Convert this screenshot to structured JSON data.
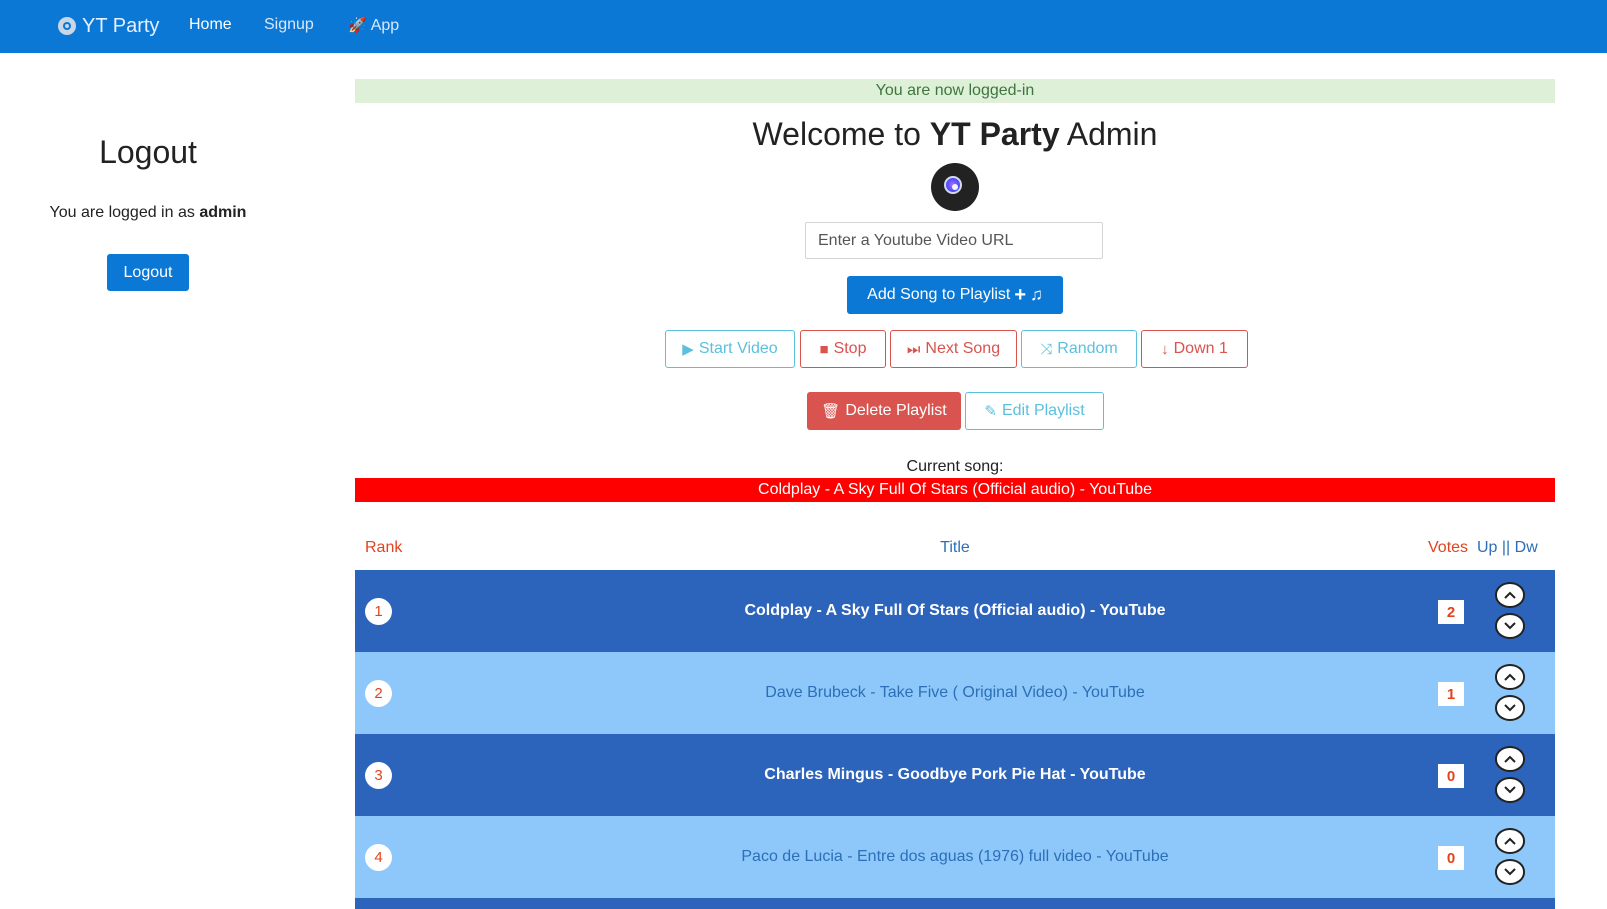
{
  "navbar": {
    "brand": "YT Party",
    "links": [
      {
        "label": "Home",
        "active": true
      },
      {
        "label": "Signup",
        "active": false
      },
      {
        "label": "App",
        "active": false,
        "icon": "rocket-icon"
      }
    ]
  },
  "sidebar": {
    "title": "Logout",
    "logged_prefix": "You are logged in as",
    "username": "admin",
    "logout_button": "Logout"
  },
  "alert": "You are now logged-in",
  "welcome": {
    "prefix": "Welcome to",
    "brand": "YT Party",
    "suffix": "Admin"
  },
  "url_input": {
    "placeholder": "Enter a Youtube Video URL",
    "value": ""
  },
  "add_button": "Add Song to Playlist",
  "controls": {
    "start": "Start Video",
    "stop": "Stop",
    "next": "Next Song",
    "random": "Random",
    "down": "Down 1",
    "delete": "Delete Playlist",
    "edit": "Edit Playlist"
  },
  "current": {
    "label": "Current song:",
    "title": "Coldplay - A Sky Full Of Stars (Official audio) - YouTube"
  },
  "table": {
    "headers": {
      "rank": "Rank",
      "title": "Title",
      "votes": "Votes",
      "updw": "Up || Dw"
    },
    "rows": [
      {
        "rank": "1",
        "title": "Coldplay - A Sky Full Of Stars (Official audio) - YouTube",
        "votes": "2"
      },
      {
        "rank": "2",
        "title": "Dave Brubeck - Take Five ( Original Video) - YouTube",
        "votes": "1"
      },
      {
        "rank": "3",
        "title": "Charles Mingus - Goodbye Pork Pie Hat - YouTube",
        "votes": "0"
      },
      {
        "rank": "4",
        "title": "Paco de Lucia - Entre dos aguas (1976) full video - YouTube",
        "votes": "0"
      }
    ]
  },
  "colors": {
    "navbar": "#0b78d6",
    "row_dark": "#2c63bb",
    "row_light": "#8ec8fa",
    "current_bar": "#ff0000",
    "alert_bg": "#dff0d8",
    "accent_red": "#e2431f"
  }
}
